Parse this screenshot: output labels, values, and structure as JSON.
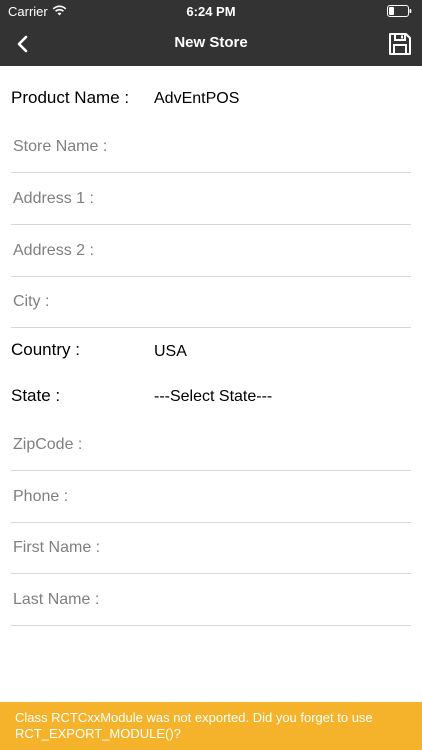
{
  "status_bar": {
    "carrier": "Carrier",
    "time": "6:24 PM"
  },
  "nav": {
    "title": "New Store"
  },
  "form": {
    "product_name": {
      "label": "Product Name :",
      "value": "AdvEntPOS"
    },
    "store_name": {
      "label": "Store Name :"
    },
    "address1": {
      "label": "Address 1 :"
    },
    "address2": {
      "label": "Address 2 :"
    },
    "city": {
      "label": "City :"
    },
    "country": {
      "label": "Country :",
      "value": "USA"
    },
    "state": {
      "label": "State :",
      "value": "---Select State---"
    },
    "zipcode": {
      "label": "ZipCode :"
    },
    "phone": {
      "label": "Phone :"
    },
    "first_name": {
      "label": "First Name :"
    },
    "last_name": {
      "label": "Last Name :"
    }
  },
  "error": {
    "message": "Class RCTCxxModule was not exported. Did you forget to use RCT_EXPORT_MODULE()?"
  },
  "colors": {
    "header": "#333333",
    "error": "#f5b32b",
    "placeholder": "#7f7f7f",
    "divider": "#d8d8d8"
  }
}
